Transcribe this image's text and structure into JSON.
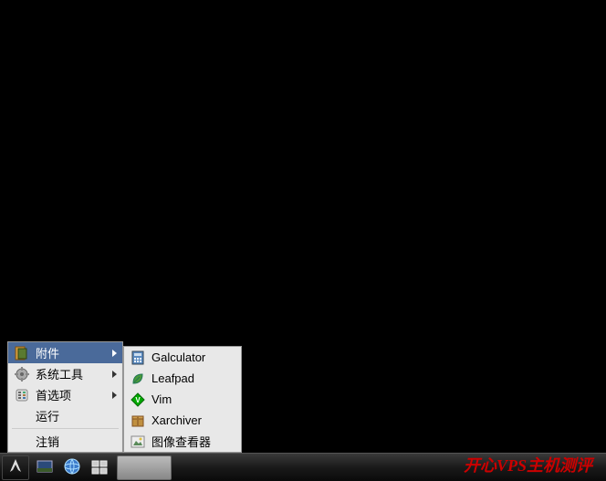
{
  "main_menu": {
    "items": [
      {
        "label": "附件",
        "icon": "accessories",
        "has_submenu": true,
        "highlighted": true
      },
      {
        "label": "系统工具",
        "icon": "system-tools",
        "has_submenu": true,
        "highlighted": false
      },
      {
        "label": "首选项",
        "icon": "preferences",
        "has_submenu": true,
        "highlighted": false
      },
      {
        "label": "运行",
        "icon": null,
        "has_submenu": false,
        "highlighted": false
      }
    ],
    "separator_after_index": 3,
    "footer_items": [
      {
        "label": "注销",
        "icon": "logout",
        "has_submenu": false
      }
    ]
  },
  "sub_menu": {
    "items": [
      {
        "label": "Galculator",
        "icon": "calculator"
      },
      {
        "label": "Leafpad",
        "icon": "leafpad"
      },
      {
        "label": "Vim",
        "icon": "vim"
      },
      {
        "label": "Xarchiver",
        "icon": "xarchiver"
      },
      {
        "label": "图像查看器",
        "icon": "image-viewer"
      }
    ]
  },
  "taskbar": {
    "start_icon": "arch-logo",
    "tray": [
      {
        "icon": "show-desktop"
      },
      {
        "icon": "web-browser"
      },
      {
        "icon": "file-manager"
      }
    ]
  },
  "watermark": "开心VPS主机测评"
}
